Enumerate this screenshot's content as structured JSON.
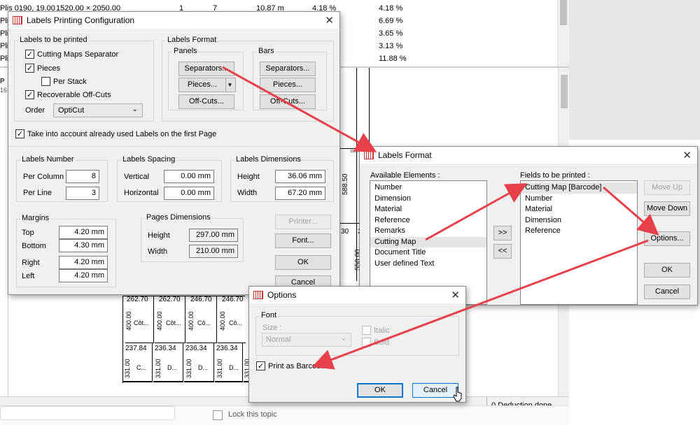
{
  "bg_rows": [
    {
      "name": "Plis 0190, 19.00",
      "dims": "1520.00 × 2050.00",
      "qty": "1",
      "n": "7",
      "len": "10.87 m",
      "pct": "4.18 %",
      "pct2": "4.18 %"
    },
    {
      "name": "Pli",
      "pct2": "6.69 %"
    },
    {
      "name": "Pli",
      "pct2": "3.65 %"
    },
    {
      "name": "Pli",
      "pct2": "3.13 %"
    },
    {
      "name": "Pli",
      "pct2": "11.88 %"
    }
  ],
  "bg_side": {
    "p": "P",
    "num": "16"
  },
  "bg_map": {
    "top_labels": [
      "588.50",
      "550.00",
      "230",
      "30"
    ],
    "row1": [
      {
        "w": "262.70",
        "h": "400.00",
        "t": "Côt..."
      },
      {
        "w": "262.70",
        "h": "400.00",
        "t": "Côt..."
      },
      {
        "w": "246.70",
        "h": "400.00",
        "t": "Cô..."
      },
      {
        "w": "246.70",
        "h": "400.00",
        "t": "Cô..."
      }
    ],
    "row2": [
      {
        "w": "237.84",
        "h": "331.00",
        "t": "C..."
      },
      {
        "w": "236.34",
        "h": "331.00",
        "t": "D..."
      },
      {
        "w": "236.34",
        "h": "331.00",
        "t": "D..."
      },
      {
        "w": "236.34",
        "h": "331.00",
        "t": "D..."
      },
      {
        "w": "",
        "h": "331.00",
        "t": "D..."
      }
    ],
    "tiny": "100.70"
  },
  "status": {
    "text": "0 Deduction done"
  },
  "lock_topic": "Lock this topic",
  "emoji": "😀😀",
  "dialog1": {
    "title": "Labels Printing Configuration",
    "labels_group": "Labels to be printed",
    "cutting_maps_sep": "Cutting Maps Separator",
    "pieces": "Pieces",
    "per_stack": "Per Stack",
    "recoverable": "Recoverable Off-Cuts",
    "order_label": "Order",
    "order_value": "OptiCut",
    "format_group": "Labels Format",
    "panels": "Panels",
    "bars": "Bars",
    "separators_btn": "Separators...",
    "pieces_btn": "Pieces...",
    "offcuts_btn": "Off-Cuts...",
    "take_into_account": "Take into account already used Labels on the first Page",
    "number_group": "Labels Number",
    "per_column": "Per Column",
    "per_column_val": "8",
    "per_line": "Per Line",
    "per_line_val": "3",
    "spacing_group": "Labels Spacing",
    "vertical": "Vertical",
    "vertical_val": "0.00 mm",
    "horizontal": "Horizontal",
    "horizontal_val": "0.00 mm",
    "dims_group": "Labels Dimensions",
    "height": "Height",
    "height_val": "36.06 mm",
    "width": "Width",
    "width_val": "67.20 mm",
    "margins_group": "Margins",
    "top": "Top",
    "top_val": "4.20 mm",
    "bottom": "Bottom",
    "bottom_val": "4.30 mm",
    "right": "Right",
    "right_val": "4.20 mm",
    "left": "Left",
    "left_val": "4.20 mm",
    "pages_group": "Pages Dimensions",
    "page_height": "Height",
    "page_height_val": "297.00 mm",
    "page_width": "Width",
    "page_width_val": "210.00 mm",
    "printer_btn": "Printer...",
    "font_btn": "Font...",
    "ok_btn": "OK",
    "cancel_btn": "Cancel"
  },
  "dialog2": {
    "title": "Labels Format",
    "available_label": "Available Elements :",
    "available": [
      "Number",
      "Dimension",
      "Material",
      "Reference",
      "Remarks",
      "Cutting Map",
      "Document Title",
      "User defined Text"
    ],
    "fields_label": "Fields to be printed :",
    "fields": [
      "Cutting Map [Barcode]",
      "Number",
      "Material",
      "Dimension",
      "Reference"
    ],
    "add_btn": ">>",
    "remove_btn": "<<",
    "move_up": "Move Up",
    "move_down": "Move Down",
    "options_btn": "Options...",
    "ok_btn": "OK",
    "cancel_btn": "Cancel"
  },
  "dialog3": {
    "title": "Options",
    "font_group": "Font",
    "size_label": "Size :",
    "size_value": "Normal",
    "italic": "Italic",
    "bold": "Bold",
    "print_barcode": "Print as Barcode",
    "ok_btn": "OK",
    "cancel_btn": "Cancel"
  },
  "colors": {
    "arrow": "#e8404a",
    "accent": "#0078d7"
  }
}
